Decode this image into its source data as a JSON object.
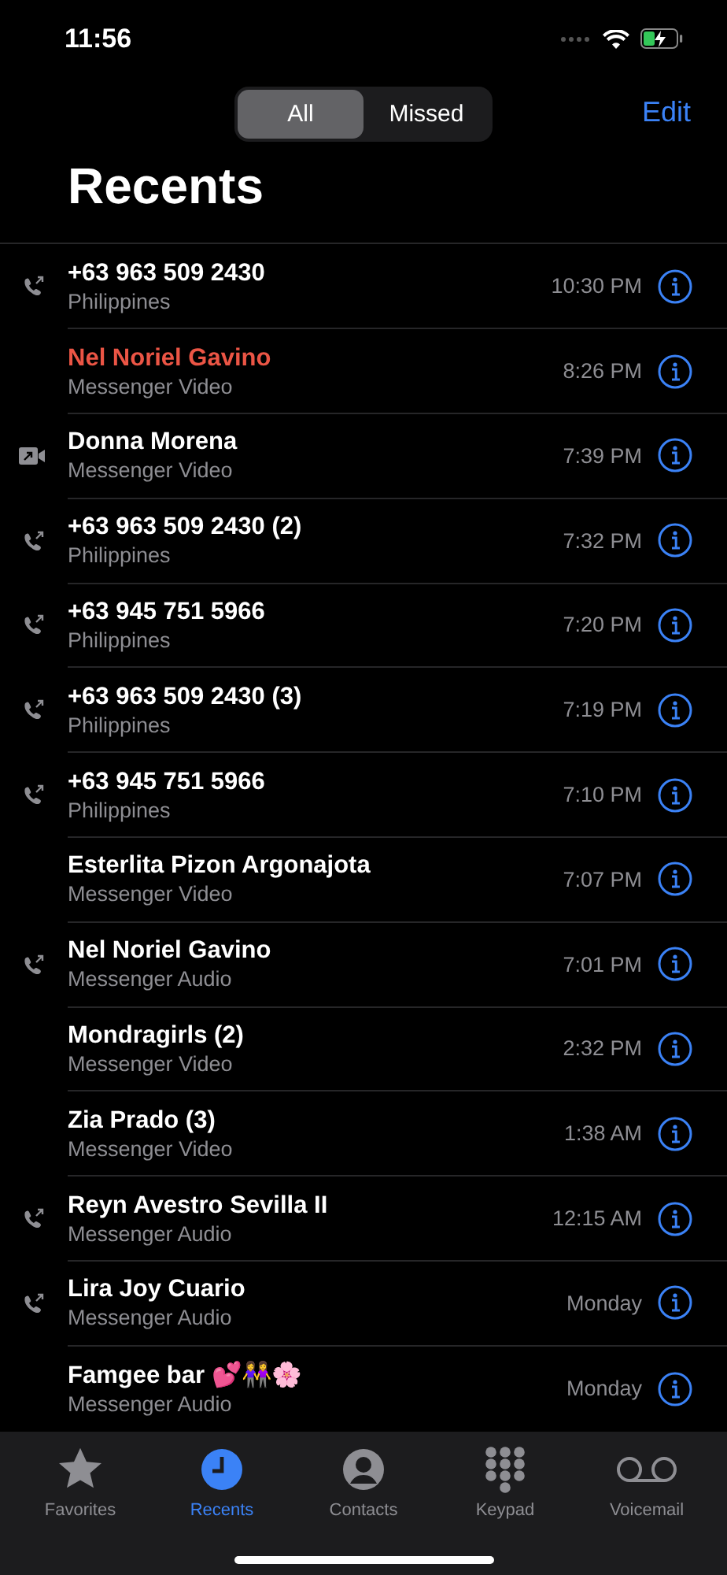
{
  "status_bar": {
    "time": "11:56"
  },
  "filter": {
    "segments": [
      {
        "label": "All",
        "selected": true
      },
      {
        "label": "Missed",
        "selected": false
      }
    ],
    "edit": "Edit"
  },
  "title": "Recents",
  "calls": [
    {
      "name": "+63 963 509 2430",
      "detail": "Philippines",
      "time": "10:30 PM",
      "kind": "call",
      "missed": false
    },
    {
      "name": "Nel Noriel Gavino",
      "detail": "Messenger Video",
      "time": "8:26 PM",
      "kind": "none",
      "missed": true
    },
    {
      "name": "Donna Morena",
      "detail": "Messenger Video",
      "time": "7:39 PM",
      "kind": "video",
      "missed": false
    },
    {
      "name": "+63 963 509 2430 (2)",
      "detail": "Philippines",
      "time": "7:32 PM",
      "kind": "call",
      "missed": false
    },
    {
      "name": "+63 945 751 5966",
      "detail": "Philippines",
      "time": "7:20 PM",
      "kind": "call",
      "missed": false
    },
    {
      "name": "+63 963 509 2430 (3)",
      "detail": "Philippines",
      "time": "7:19 PM",
      "kind": "call",
      "missed": false
    },
    {
      "name": "+63 945 751 5966",
      "detail": "Philippines",
      "time": "7:10 PM",
      "kind": "call",
      "missed": false
    },
    {
      "name": "Esterlita Pizon Argonajota",
      "detail": "Messenger Video",
      "time": "7:07 PM",
      "kind": "none",
      "missed": false
    },
    {
      "name": "Nel Noriel Gavino",
      "detail": "Messenger Audio",
      "time": "7:01 PM",
      "kind": "call",
      "missed": false
    },
    {
      "name": "Mondragirls (2)",
      "detail": "Messenger Video",
      "time": "2:32 PM",
      "kind": "none",
      "missed": false
    },
    {
      "name": "Zia Prado (3)",
      "detail": "Messenger Video",
      "time": "1:38 AM",
      "kind": "none",
      "missed": false
    },
    {
      "name": "Reyn Avestro Sevilla II",
      "detail": "Messenger Audio",
      "time": "12:15 AM",
      "kind": "call",
      "missed": false
    },
    {
      "name": "Lira Joy Cuario",
      "detail": "Messenger Audio",
      "time": "Monday",
      "kind": "call",
      "missed": false
    },
    {
      "name": "Famgee bar 💕👭🌸",
      "detail": "Messenger Audio",
      "time": "Monday",
      "kind": "none",
      "missed": false
    }
  ],
  "tab_bar": [
    {
      "label": "Favorites",
      "kind": "star",
      "selected": false
    },
    {
      "label": "Recents",
      "kind": "clock",
      "selected": true
    },
    {
      "label": "Contacts",
      "kind": "person",
      "selected": false
    },
    {
      "label": "Keypad",
      "kind": "keypad",
      "selected": false
    },
    {
      "label": "Voicemail",
      "kind": "voicemail",
      "selected": false
    }
  ]
}
